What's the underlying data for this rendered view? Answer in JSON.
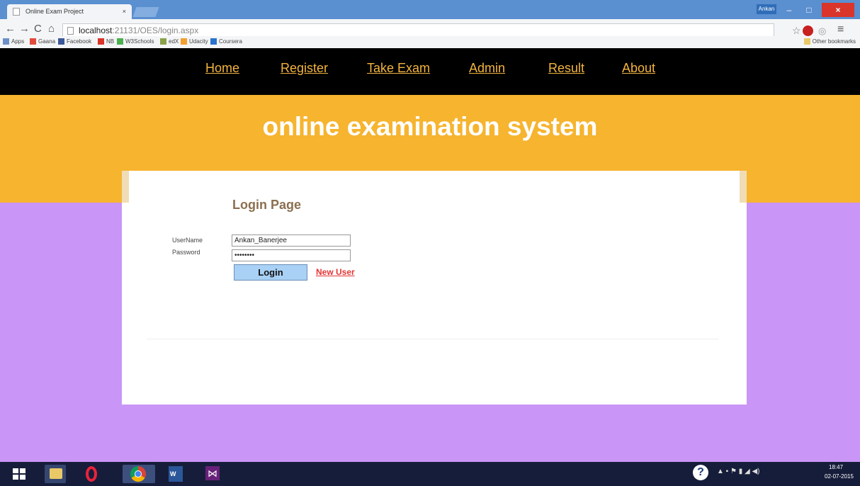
{
  "browser": {
    "tab_title": "Online Exam Project",
    "tab_close": "×",
    "profile_name": "Ankan",
    "url_host": "localhost",
    "url_rest": ":21131/OES/login.aspx",
    "window_minimize": "–",
    "window_maximize": "□",
    "window_close": "×",
    "back": "←",
    "forward": "→",
    "reload": "C",
    "home": "⌂",
    "star": "☆",
    "extension": "◎",
    "menu": "≡",
    "bookmarks": [
      {
        "label": "Apps",
        "color": "#6d8fc7"
      },
      {
        "label": "Gaana",
        "color": "#e14b3b"
      },
      {
        "label": "Facebook",
        "color": "#3b5998"
      },
      {
        "label": "NB",
        "color": "#d9352a"
      },
      {
        "label": "W3Schools",
        "color": "#4caf50"
      },
      {
        "label": "edX",
        "color": "#8aa14a"
      },
      {
        "label": "Udacity",
        "color": "#f2a02e"
      },
      {
        "label": "Coursera",
        "color": "#2a73cc"
      }
    ],
    "other_bookmarks": "Other bookmarks"
  },
  "nav": {
    "home": "Home",
    "register": "Register",
    "take_exam": "Take Exam",
    "admin": "Admin",
    "result": "Result",
    "about": "About"
  },
  "site": {
    "title": "online examination system"
  },
  "login": {
    "heading": "Login Page",
    "username_label": "UserName",
    "password_label": "Password",
    "username_value": "Ankan_Banerjee",
    "password_value": "••••••••",
    "login_button": "Login",
    "new_user_link": "New User"
  },
  "taskbar": {
    "help": "?",
    "word_label": "W",
    "vs_label": "⋈",
    "tray": "▲  ▪  ⚑  ▮  ◢  ◀)",
    "time": "18:47",
    "date": "02-07-2015"
  },
  "colors": {
    "nav_bg": "#000000",
    "nav_link": "#f3b43d",
    "banner": "#f6b42f",
    "page_bg": "#c995f6",
    "heading": "#8b6f4f",
    "login_button_bg": "#a9d0f5",
    "new_user_link": "#e53434"
  }
}
